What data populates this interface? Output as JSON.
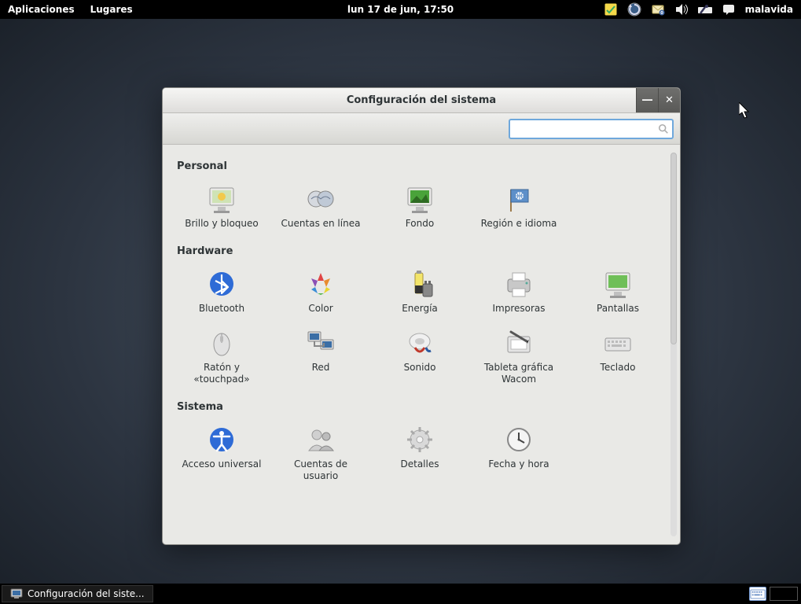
{
  "top_panel": {
    "applications": "Aplicaciones",
    "places": "Lugares",
    "clock": "lun 17 de jun, 17:50",
    "username": "malavida"
  },
  "bottom_panel": {
    "task_label": "Configuración del siste..."
  },
  "window": {
    "title": "Configuración del sistema",
    "search_placeholder": ""
  },
  "sections": {
    "personal": {
      "title": "Personal",
      "items": [
        {
          "name": "brightness-lock",
          "label": "Brillo y bloqueo"
        },
        {
          "name": "online-accounts",
          "label": "Cuentas en línea"
        },
        {
          "name": "background",
          "label": "Fondo"
        },
        {
          "name": "region-language",
          "label": "Región e idioma"
        }
      ]
    },
    "hardware": {
      "title": "Hardware",
      "items": [
        {
          "name": "bluetooth",
          "label": "Bluetooth"
        },
        {
          "name": "color",
          "label": "Color"
        },
        {
          "name": "power",
          "label": "Energía"
        },
        {
          "name": "printers",
          "label": "Impresoras"
        },
        {
          "name": "displays",
          "label": "Pantallas"
        },
        {
          "name": "mouse-touchpad",
          "label": "Ratón y «touchpad»"
        },
        {
          "name": "network",
          "label": "Red"
        },
        {
          "name": "sound",
          "label": "Sonido"
        },
        {
          "name": "wacom",
          "label": "Tableta gráfica Wacom"
        },
        {
          "name": "keyboard",
          "label": "Teclado"
        }
      ]
    },
    "system": {
      "title": "Sistema",
      "items": [
        {
          "name": "universal-access",
          "label": "Acceso universal"
        },
        {
          "name": "user-accounts",
          "label": "Cuentas de usuario"
        },
        {
          "name": "details",
          "label": "Detalles"
        },
        {
          "name": "date-time",
          "label": "Fecha y hora"
        }
      ]
    }
  }
}
